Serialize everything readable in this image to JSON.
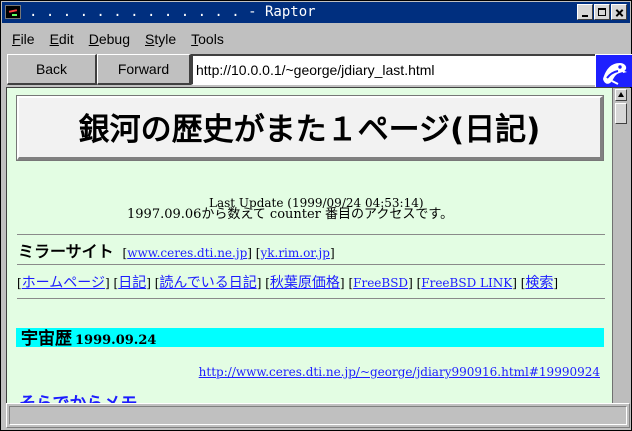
{
  "window": {
    "title": ". . . . . . . . . . . . . - Raptor",
    "controls": {
      "minimize": "minimize",
      "maximize": "maximize",
      "close": "close"
    }
  },
  "menu": {
    "items": [
      "File",
      "Edit",
      "Debug",
      "Style",
      "Tools"
    ]
  },
  "toolbar": {
    "back_label": "Back",
    "forward_label": "Forward",
    "url": "http://10.0.0.1/~george/jdiary_last.html",
    "logo_icon": "raptor-logo-icon"
  },
  "page": {
    "title": "銀河の歴史がまた１ページ(日記)",
    "last_update": "Last Update (1999/09/24 04:53:14)",
    "counter_line": "1997.09.06から数えて counter 番目のアクセスです。",
    "mirror": {
      "label": "ミラーサイト",
      "links": [
        "www.ceres.dti.ne.jp",
        "yk.rim.or.jp"
      ]
    },
    "nav_links": [
      "ホームページ",
      "日記",
      "読んでいる日記",
      "秋葉原価格",
      "FreeBSD",
      "FreeBSD LINK",
      "検索"
    ],
    "section": {
      "heading": "宇宙歴",
      "date": "1999.09.24"
    },
    "entry_link": "http://www.ceres.dti.ne.jp/~george/jdiary990916.html#19990924",
    "cut_heading": "そらでからメモ"
  },
  "status": {
    "text": ""
  },
  "colors": {
    "title_bar": "#002f7f",
    "page_background": "#e3fde3",
    "section_highlight": "#00ffff",
    "link": "#1c1cff"
  }
}
